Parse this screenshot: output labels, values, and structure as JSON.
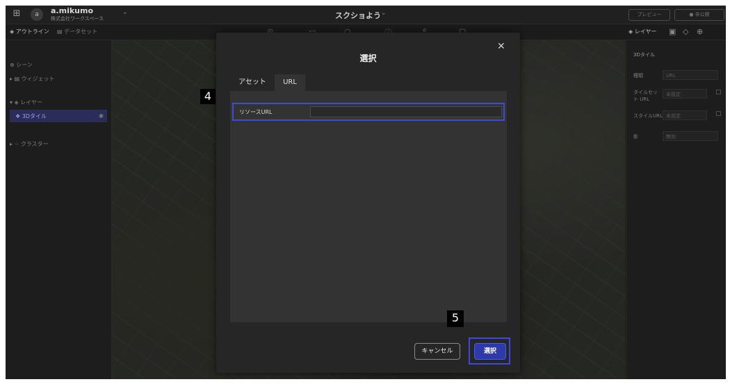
{
  "header": {
    "grid_icon": "grid-icon",
    "avatar_text": "a",
    "user_name": "a.mikumo",
    "workspace": "株式会社ワークスペース",
    "project_title": "スクショよう",
    "preview_button": "プレビュー",
    "publish_button": "● 非公開"
  },
  "toolbar": {
    "outline_tab": "アウトライン",
    "dataset_tab": "データセット",
    "layers_tab": "レイヤー"
  },
  "left_panel": {
    "scene": "シーン",
    "widgets": "ウィジェット",
    "layers": "レイヤー",
    "layer_item": "3Dタイル",
    "cluster": "クラスター"
  },
  "right_panel": {
    "section": "3Dタイル",
    "type_label": "種類",
    "type_value": "URL",
    "tileset_label": "タイルセット URL",
    "tileset_value": "未設定",
    "style_label": "スタイルURL",
    "style_value": "未設定",
    "shadow_label": "影",
    "shadow_value": "無効"
  },
  "dialog": {
    "title": "選択",
    "tabs": [
      "アセット",
      "URL"
    ],
    "active_tab": "URL",
    "field_label": "リソースURL",
    "field_value": "",
    "cancel": "キャンセル",
    "select": "選択"
  },
  "annotations": {
    "step4": "4",
    "step5": "5"
  },
  "colors": {
    "highlight": "#3f4bd6",
    "primary_button": "#2d3aa8",
    "dialog_bg": "#262626",
    "dialog_body": "#333333"
  }
}
